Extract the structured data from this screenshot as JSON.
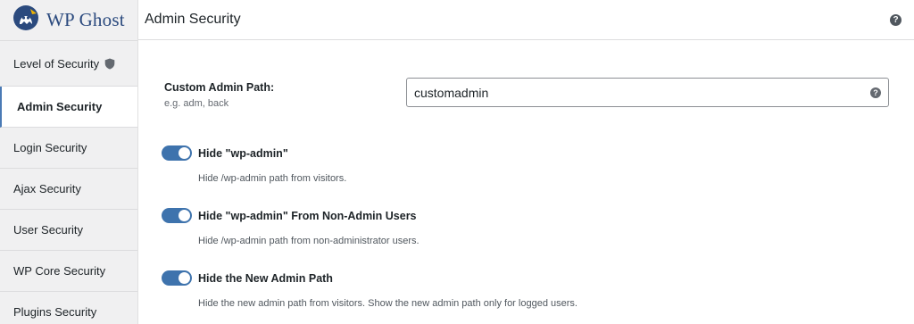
{
  "brand": {
    "name": "WP Ghost"
  },
  "sidebar": {
    "items": [
      {
        "label": "Level of Security",
        "icon": "shield-icon"
      },
      {
        "label": "Admin Security"
      },
      {
        "label": "Login Security"
      },
      {
        "label": "Ajax Security"
      },
      {
        "label": "User Security"
      },
      {
        "label": "WP Core Security"
      },
      {
        "label": "Plugins Security"
      }
    ],
    "active_index": 1
  },
  "header": {
    "title": "Admin Security",
    "help_glyph": "?"
  },
  "custom_path": {
    "label": "Custom Admin Path:",
    "hint": "e.g. adm, back",
    "value": "customadmin",
    "help_glyph": "?"
  },
  "options": [
    {
      "label": "Hide \"wp-admin\"",
      "description": "Hide /wp-admin path from visitors.",
      "enabled": true
    },
    {
      "label": "Hide \"wp-admin\" From Non-Admin Users",
      "description": "Hide /wp-admin path from non-administrator users.",
      "enabled": true
    },
    {
      "label": "Hide the New Admin Path",
      "description": "Hide the new admin path from visitors. Show the new admin path only for logged users.",
      "enabled": true
    }
  ],
  "colors": {
    "accent": "#3e73ad",
    "brand": "#2b4a7e",
    "sidebar_bg": "#f0f0f1"
  }
}
